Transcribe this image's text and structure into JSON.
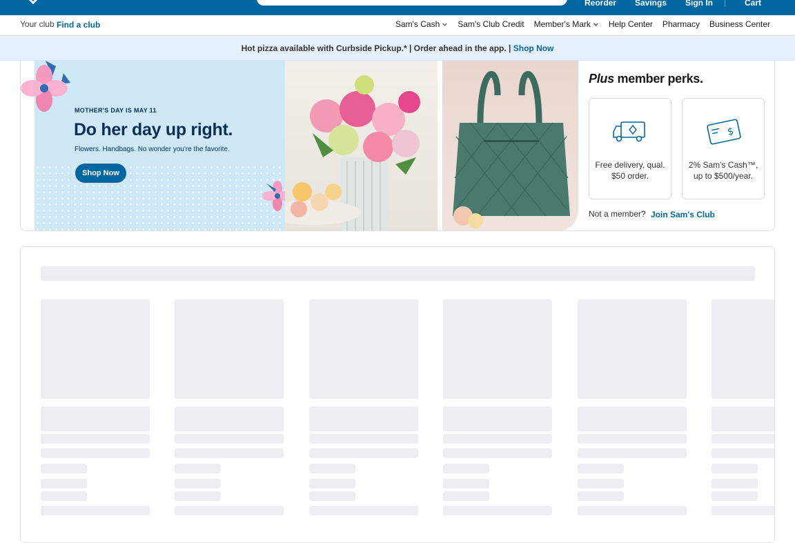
{
  "header": {
    "nav_items": [
      "Reorder",
      "Savings",
      "Sign In",
      "Cart"
    ]
  },
  "subnav": {
    "club_label": "Your club",
    "club_link": "Find a club",
    "items": [
      {
        "label": "Sam's Cash",
        "dropdown": true
      },
      {
        "label": "Sam's Club Credit",
        "dropdown": false
      },
      {
        "label": "Member's Mark",
        "dropdown": true
      },
      {
        "label": "Help Center",
        "dropdown": false
      },
      {
        "label": "Pharmacy",
        "dropdown": false
      },
      {
        "label": "Business Center",
        "dropdown": false
      }
    ]
  },
  "promo": {
    "text": "Hot pizza available with Curbside Pickup.* | Order ahead in the app. |",
    "link": "Shop Now"
  },
  "hero": {
    "eyebrow": "MOTHER'S DAY IS MAY 11",
    "headline": "Do her day up right.",
    "subhead": "Flowers. Handbags. No wonder you're the favorite.",
    "button": "Shop Now"
  },
  "perks": {
    "title_italic": "Plus",
    "title_rest": " member perks.",
    "items": [
      {
        "icon": "delivery-truck-icon",
        "text": "Free delivery, qual. $50 order."
      },
      {
        "icon": "sams-cash-card-icon",
        "text": "2% Sam's Cash™, up to $500/year."
      }
    ],
    "not_member": "Not a member?",
    "join_link": "Join Sam's Club"
  },
  "colors": {
    "brand_blue": "#0067a0",
    "navy": "#0c2d57",
    "skeleton": "#eceef1",
    "promo_bg": "#e6f0fa"
  }
}
